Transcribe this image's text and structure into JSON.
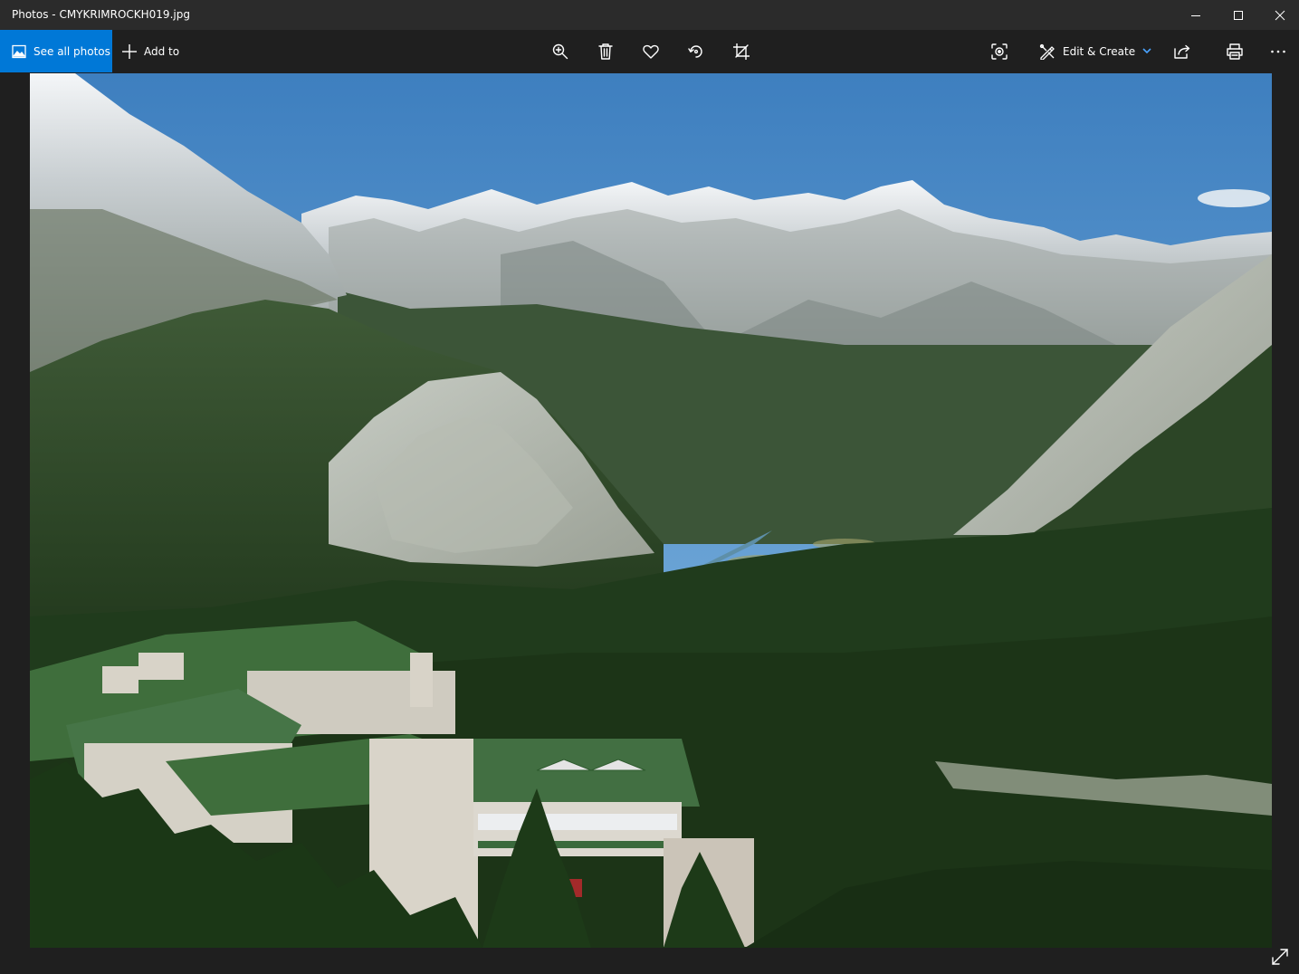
{
  "window": {
    "title": "Photos - CMYKRIMROCKH019.jpg"
  },
  "toolbar": {
    "see_all_photos": "See all photos",
    "add_to": "Add to",
    "edit_create": "Edit & Create",
    "icons": [
      "picture-icon",
      "plus-icon",
      "zoom-icon",
      "trash-icon",
      "heart-icon",
      "rotate-icon",
      "crop-icon",
      "enhance-icon",
      "edit-create-icon",
      "share-icon",
      "print-icon",
      "more-icon"
    ]
  },
  "colors": {
    "accent": "#0078d7",
    "titlebar": "#2b2b2b",
    "background": "#1f1f1f"
  },
  "photo": {
    "subject": "mountain-valley-hotel-landscape"
  }
}
